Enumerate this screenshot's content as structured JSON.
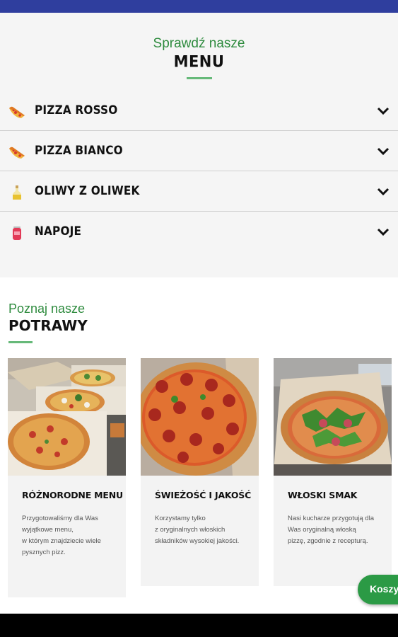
{
  "menu": {
    "subtitle": "Sprawdź nasze",
    "title": "MENU",
    "items": [
      {
        "label": "PIZZA ROSSO",
        "icon": "pizza-slice-icon"
      },
      {
        "label": "PIZZA BIANCO",
        "icon": "pizza-slice-icon"
      },
      {
        "label": "OLIWY Z OLIWEK",
        "icon": "olive-oil-bottle-icon"
      },
      {
        "label": "NAPOJE",
        "icon": "drink-can-icon"
      }
    ]
  },
  "dishes": {
    "subtitle": "Poznaj nasze",
    "title": "POTRAWY",
    "cards": [
      {
        "title": "RÓŻNORODNE MENU",
        "lines": [
          "Przygotowaliśmy dla Was",
          "wyjątkowe menu,",
          "w którym znajdziecie wiele",
          "pysznych pizz."
        ]
      },
      {
        "title": "ŚWIEŻOŚĆ I JAKOŚĆ",
        "lines": [
          "Korzystamy tylko",
          "z oryginalnych włoskich",
          "składników wysokiej jakości."
        ]
      },
      {
        "title": "WŁOSKI SMAK",
        "lines": [
          "Nasi kucharze przygotują dla",
          "Was oryginalną włoską",
          "pizzę, zgodnie z recepturą."
        ]
      }
    ]
  },
  "cart": {
    "label": "Koszyk"
  },
  "colors": {
    "accent_green": "#2e8b3e",
    "status_bar": "#2f3e9e",
    "cart_button": "#2b9a45"
  }
}
